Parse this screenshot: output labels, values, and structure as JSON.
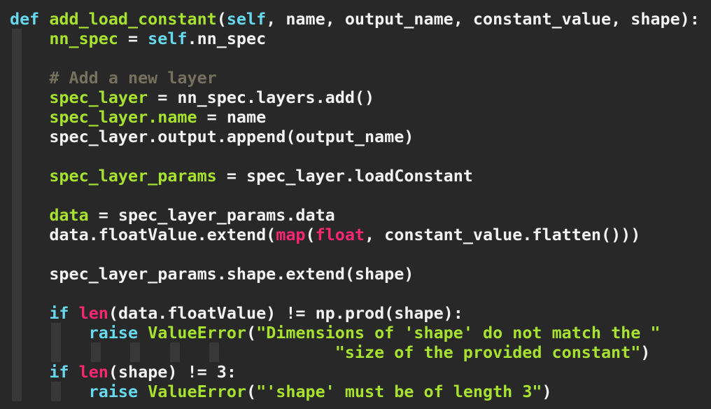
{
  "colors": {
    "background": "#282828",
    "default_text": "#f2f2f2",
    "keyword": "#66d9ef",
    "function_name": "#a6e22e",
    "comment": "#75715e",
    "builtin": "#f92672",
    "string": "#a6e22e",
    "indent_guide": "#383838"
  },
  "code": {
    "lines": [
      [
        {
          "t": "def",
          "c": "kw"
        },
        {
          "t": " ",
          "c": "txt"
        },
        {
          "t": "add_load_constant",
          "c": "fn"
        },
        {
          "t": "(",
          "c": "txt"
        },
        {
          "t": "self",
          "c": "self"
        },
        {
          "t": ", name, output_name, constant_value, shape):",
          "c": "txt"
        }
      ],
      [
        {
          "t": "    ",
          "c": "txt"
        },
        {
          "t": "nn_spec",
          "c": "var"
        },
        {
          "t": " = ",
          "c": "txt"
        },
        {
          "t": "self",
          "c": "self"
        },
        {
          "t": ".nn_spec",
          "c": "txt"
        }
      ],
      [],
      [
        {
          "t": "    ",
          "c": "txt"
        },
        {
          "t": "# Add a new layer",
          "c": "cm"
        }
      ],
      [
        {
          "t": "    ",
          "c": "txt"
        },
        {
          "t": "spec_layer",
          "c": "var"
        },
        {
          "t": " = nn_spec.layers.add()",
          "c": "txt"
        }
      ],
      [
        {
          "t": "    ",
          "c": "txt"
        },
        {
          "t": "spec_layer.name",
          "c": "var"
        },
        {
          "t": " = name",
          "c": "txt"
        }
      ],
      [
        {
          "t": "    ",
          "c": "txt"
        },
        {
          "t": "spec_layer.output.append(output_name)",
          "c": "txt"
        }
      ],
      [],
      [
        {
          "t": "    ",
          "c": "txt"
        },
        {
          "t": "spec_layer_params",
          "c": "var"
        },
        {
          "t": " = spec_layer.loadConstant",
          "c": "txt"
        }
      ],
      [],
      [
        {
          "t": "    ",
          "c": "txt"
        },
        {
          "t": "data",
          "c": "var"
        },
        {
          "t": " = spec_layer_params.data",
          "c": "txt"
        }
      ],
      [
        {
          "t": "    ",
          "c": "txt"
        },
        {
          "t": "data.floatValue.extend(",
          "c": "txt"
        },
        {
          "t": "map",
          "c": "bi"
        },
        {
          "t": "(",
          "c": "txt"
        },
        {
          "t": "float",
          "c": "bi"
        },
        {
          "t": ", constant_value.flatten()))",
          "c": "txt"
        }
      ],
      [],
      [
        {
          "t": "    ",
          "c": "txt"
        },
        {
          "t": "spec_layer_params.shape.extend(shape)",
          "c": "txt"
        }
      ],
      [],
      [
        {
          "t": "    ",
          "c": "txt"
        },
        {
          "t": "if",
          "c": "kw"
        },
        {
          "t": " ",
          "c": "txt"
        },
        {
          "t": "len",
          "c": "bi"
        },
        {
          "t": "(data.floatValue) != np.prod(shape):",
          "c": "txt"
        }
      ],
      [
        {
          "t": "        ",
          "c": "txt"
        },
        {
          "t": "raise",
          "c": "kw"
        },
        {
          "t": " ",
          "c": "txt"
        },
        {
          "t": "ValueError",
          "c": "cls"
        },
        {
          "t": "(",
          "c": "txt"
        },
        {
          "t": "\"Dimensions of 'shape' do not match the \"",
          "c": "str"
        }
      ],
      [
        {
          "t": "                                 ",
          "c": "txt"
        },
        {
          "t": "\"size of the provided constant\"",
          "c": "str"
        },
        {
          "t": ")",
          "c": "txt"
        }
      ],
      [
        {
          "t": "    ",
          "c": "txt"
        },
        {
          "t": "if",
          "c": "kw"
        },
        {
          "t": " ",
          "c": "txt"
        },
        {
          "t": "len",
          "c": "bi"
        },
        {
          "t": "(shape) != 3:",
          "c": "txt"
        }
      ],
      [
        {
          "t": "        ",
          "c": "txt"
        },
        {
          "t": "raise",
          "c": "kw"
        },
        {
          "t": " ",
          "c": "txt"
        },
        {
          "t": "ValueError",
          "c": "cls"
        },
        {
          "t": "(",
          "c": "txt"
        },
        {
          "t": "\"'shape' must be of length 3\"",
          "c": "str"
        },
        {
          "t": ")",
          "c": "txt"
        }
      ]
    ]
  }
}
